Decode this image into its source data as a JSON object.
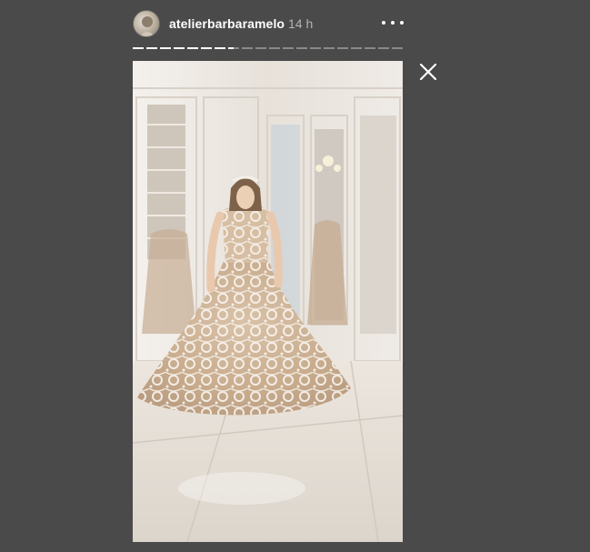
{
  "header": {
    "username": "atelierbarbaramelo",
    "time": "14 h",
    "avatar_icon": "avatar-image",
    "more_icon": "more-options-icon"
  },
  "progress": {
    "segments_total": 20,
    "current_segment": 8,
    "current_progress": 0.5
  },
  "close_icon": "close-icon",
  "media": {
    "kind": "story-photo"
  },
  "colors": {
    "background": "#4a4a4a",
    "text": "#ffffff",
    "muted_text": "#b5b5b5"
  }
}
